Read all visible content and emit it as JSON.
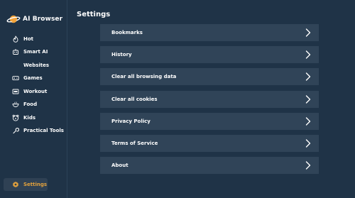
{
  "app": {
    "name": "AI Browser"
  },
  "sidebar": {
    "items": [
      {
        "label": "Hot",
        "icon": "flame-icon"
      },
      {
        "label": "Smart AI",
        "icon": "robot-icon"
      },
      {
        "label": "Websites",
        "icon": ""
      },
      {
        "label": "Games",
        "icon": "gamepad-icon"
      },
      {
        "label": "Workout",
        "icon": "dumbbell-icon"
      },
      {
        "label": "Food",
        "icon": "bowl-icon"
      },
      {
        "label": "Kids",
        "icon": "kids-icon"
      },
      {
        "label": "Practical Tools",
        "icon": "wrench-icon"
      }
    ],
    "active": {
      "label": "Settings",
      "icon": "settings-gear-icon"
    }
  },
  "main": {
    "title": "Settings",
    "rows": [
      {
        "label": "Bookmarks"
      },
      {
        "label": "History"
      },
      {
        "label": "Clear all browsing data"
      },
      {
        "label": "Clear all cookies"
      },
      {
        "label": "Privacy Policy"
      },
      {
        "label": "Terms of Service"
      },
      {
        "label": "About"
      }
    ]
  },
  "colors": {
    "background": "#1f3347",
    "row": "#304458",
    "active_accent": "#e2a13c",
    "logo_orange": "#f2a33a"
  }
}
